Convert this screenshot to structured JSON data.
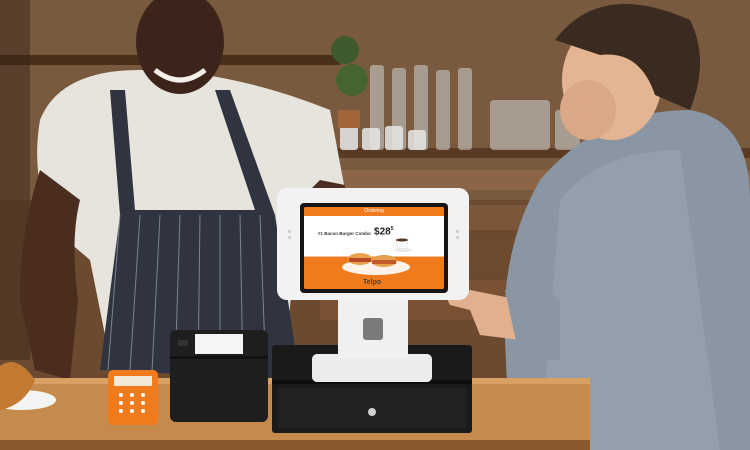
{
  "photo": {
    "description_icon": "pos-terminal-scene"
  },
  "terminal": {
    "brand_logo": "Telpo",
    "screen": {
      "top_title": "Ordering",
      "top_left": "",
      "top_right": "",
      "caption": "#1 Bacon Burger Combo",
      "price_main": "28",
      "price_cents": "5"
    }
  },
  "colors": {
    "accent_orange": "#f07b1d",
    "counter_wood": "#c68a4c",
    "terminal_white": "#eeeeee",
    "drawer_black": "#1a1a1a"
  }
}
